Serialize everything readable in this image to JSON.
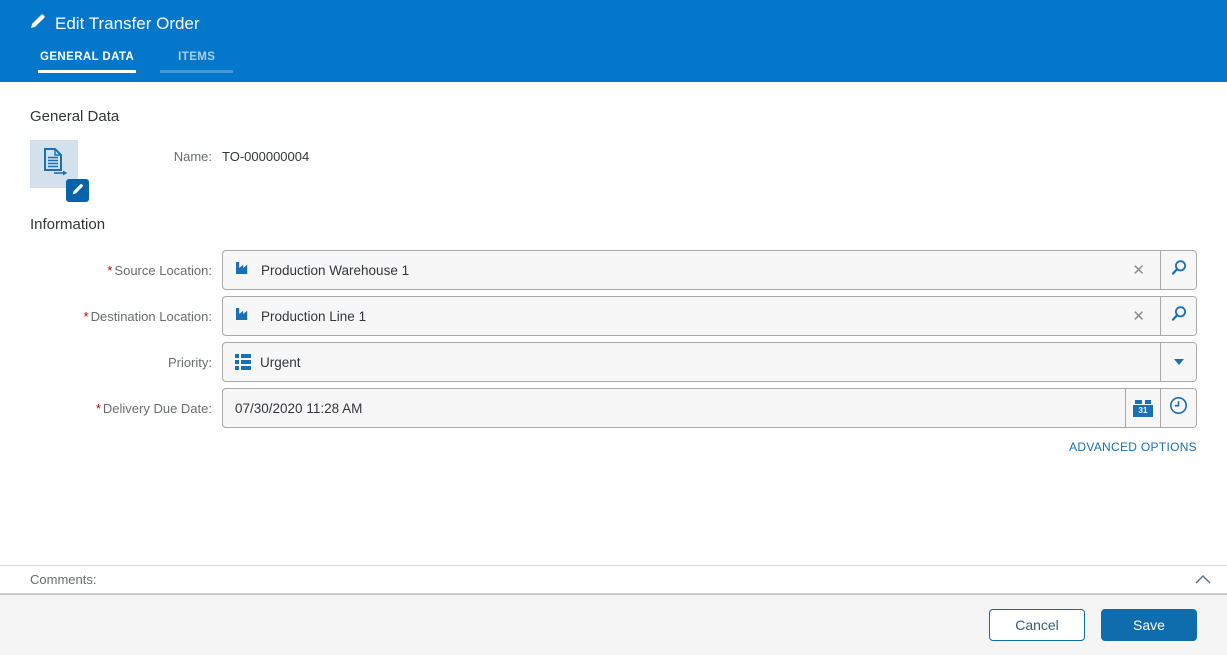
{
  "header": {
    "title": "Edit Transfer Order",
    "tabs": [
      {
        "label": "GENERAL DATA",
        "active": true
      },
      {
        "label": "ITEMS",
        "active": false
      }
    ]
  },
  "general_data": {
    "section_title": "General Data",
    "name_label": "Name:",
    "name_value": "TO-000000004"
  },
  "information": {
    "section_title": "Information",
    "fields": {
      "source_location": {
        "label": "Source Location:",
        "required": true,
        "value": "Production Warehouse 1"
      },
      "destination_location": {
        "label": "Destination Location:",
        "required": true,
        "value": "Production Line 1"
      },
      "priority": {
        "label": "Priority:",
        "required": false,
        "value": "Urgent"
      },
      "delivery_due_date": {
        "label": "Delivery Due Date:",
        "required": true,
        "value": "07/30/2020 11:28 AM"
      }
    }
  },
  "advanced_options": {
    "label": "ADVANCED OPTIONS"
  },
  "comments": {
    "label": "Comments:"
  },
  "footer": {
    "cancel_label": "Cancel",
    "save_label": "Save"
  },
  "misc": {
    "required_marker": "*"
  },
  "icons": {
    "header_edit": "pencil-icon",
    "document": "document-with-arrow-icon",
    "edit_badge": "pencil-icon",
    "location": "factory-icon",
    "clear_glyph": "✕",
    "search": "magnifier-icon",
    "priority": "list-icon",
    "dropdown": "chevron-down-icon",
    "calendar_day": "31",
    "clock": "clock-icon",
    "collapse": "chevron-up-icon"
  },
  "colors": {
    "header_bg": "#0577cb",
    "accent_blue": "#1a6fb5",
    "save_bg": "#0f6dad",
    "field_bg": "#f7f7f7",
    "field_border": "#a9a9a9",
    "label_gray": "#6a6d70",
    "text_dark": "#32363a",
    "required_red": "#bb0000",
    "footer_bg": "#f5f5f5",
    "avatar_bg": "#d3e1ed",
    "badge_bg": "#0a63a8"
  }
}
